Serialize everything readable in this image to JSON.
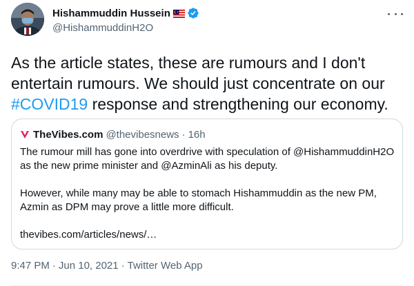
{
  "author": {
    "display_name": "Hishammuddin Hussein",
    "handle": "@HishammuddinH2O",
    "flag": "malaysia-flag-icon",
    "verified": "verified-badge-icon"
  },
  "tweet": {
    "text_part1": "As the article states, these are rumours and I don't entertain rumours. We should just concentrate on our ",
    "hashtag": "#COVID19",
    "text_part2": " response and strengthening our economy."
  },
  "quoted": {
    "display_name": "TheVibes.com",
    "handle": "@thevibesnews",
    "separator": "·",
    "time": "16h",
    "paragraph1": "The rumour mill has gone into overdrive with speculation of @HishammuddinH2O as the new prime minister and @AzminAli as his deputy.",
    "paragraph2": "However, while many may be able to stomach Hishammuddin as the new PM, Azmin as DPM may prove a little more difficult.",
    "link": "thevibes.com/articles/news/…"
  },
  "meta": {
    "time": "9:47 PM",
    "separator": "·",
    "date": "Jun 10, 2021",
    "app": "Twitter Web App"
  },
  "colors": {
    "accent": "#1d9bf0",
    "text": "#0f1419",
    "secondary": "#536471",
    "border": "#cfd9de",
    "vibes_logo": "#e0245e"
  }
}
